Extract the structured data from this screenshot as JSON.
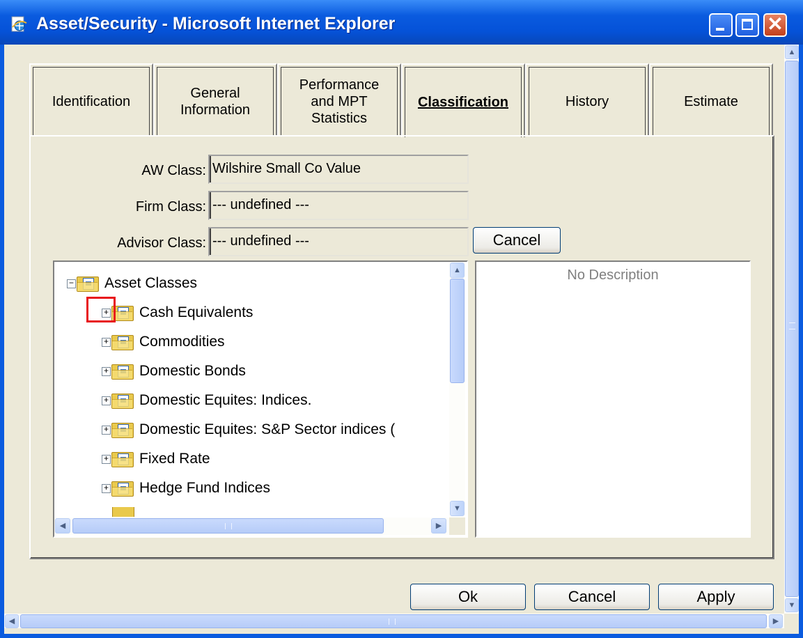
{
  "window": {
    "title": "Asset/Security - Microsoft Internet Explorer",
    "controls": {
      "minimize": "minimize",
      "maximize": "maximize",
      "close": "close"
    }
  },
  "tabs": [
    {
      "label": "Identification",
      "active": false
    },
    {
      "label": "General\nInformation",
      "active": false
    },
    {
      "label": "Performance\nand MPT\nStatistics",
      "active": false
    },
    {
      "label": "Classification",
      "active": true
    },
    {
      "label": "History",
      "active": false
    },
    {
      "label": "Estimate",
      "active": false
    }
  ],
  "classification": {
    "aw_class_label": "AW Class:",
    "aw_class_value": "Wilshire Small Co Value",
    "firm_class_label": "Firm Class:",
    "firm_class_value": "--- undefined ---",
    "advisor_class_label": "Advisor Class:",
    "advisor_class_value": "--- undefined ---",
    "cancel_label": "Cancel"
  },
  "tree": {
    "root": {
      "label": "Asset Classes",
      "expander": "−"
    },
    "items": [
      {
        "label": "Cash Equivalents",
        "expander": "+"
      },
      {
        "label": "Commodities",
        "expander": "+"
      },
      {
        "label": "Domestic Bonds",
        "expander": "+"
      },
      {
        "label": "Domestic Equites: Indices.",
        "expander": "+"
      },
      {
        "label": "Domestic Equites: S&P Sector indices (",
        "expander": "+"
      },
      {
        "label": "Fixed Rate",
        "expander": "+"
      },
      {
        "label": "Hedge Fund Indices",
        "expander": "+"
      }
    ]
  },
  "description": {
    "text": "No Description"
  },
  "footer": {
    "ok_label": "Ok",
    "cancel_label": "Cancel",
    "apply_label": "Apply"
  },
  "colors": {
    "titlebar": "#0A5BDF",
    "face": "#ECE9D8",
    "highlight": "#E8141A"
  }
}
